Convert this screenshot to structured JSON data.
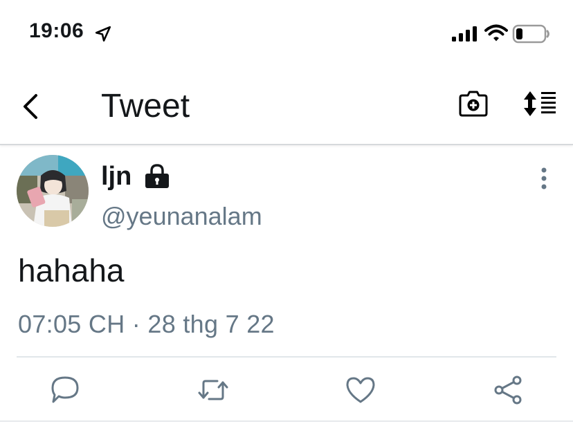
{
  "status_bar": {
    "time": "19:06",
    "icons": [
      "location-arrow-icon",
      "cellular-signal-icon",
      "wifi-icon",
      "battery-icon"
    ]
  },
  "nav": {
    "title": "Tweet",
    "icons": [
      "back-chevron-icon",
      "camera-add-icon",
      "sort-icon"
    ]
  },
  "tweet": {
    "user_name": "ljn",
    "handle": "@yeunanalam",
    "text": "hahaha",
    "timestamp": "07:05 CH · 28 thg 7 22",
    "protected_icon": "lock-icon"
  },
  "actions": [
    "reply-icon",
    "retweet-icon",
    "like-icon",
    "share-icon"
  ],
  "colors": {
    "text_primary": "#14171a",
    "text_secondary": "#657786",
    "icon_gray": "#657786",
    "divider": "#e1e6ea"
  }
}
